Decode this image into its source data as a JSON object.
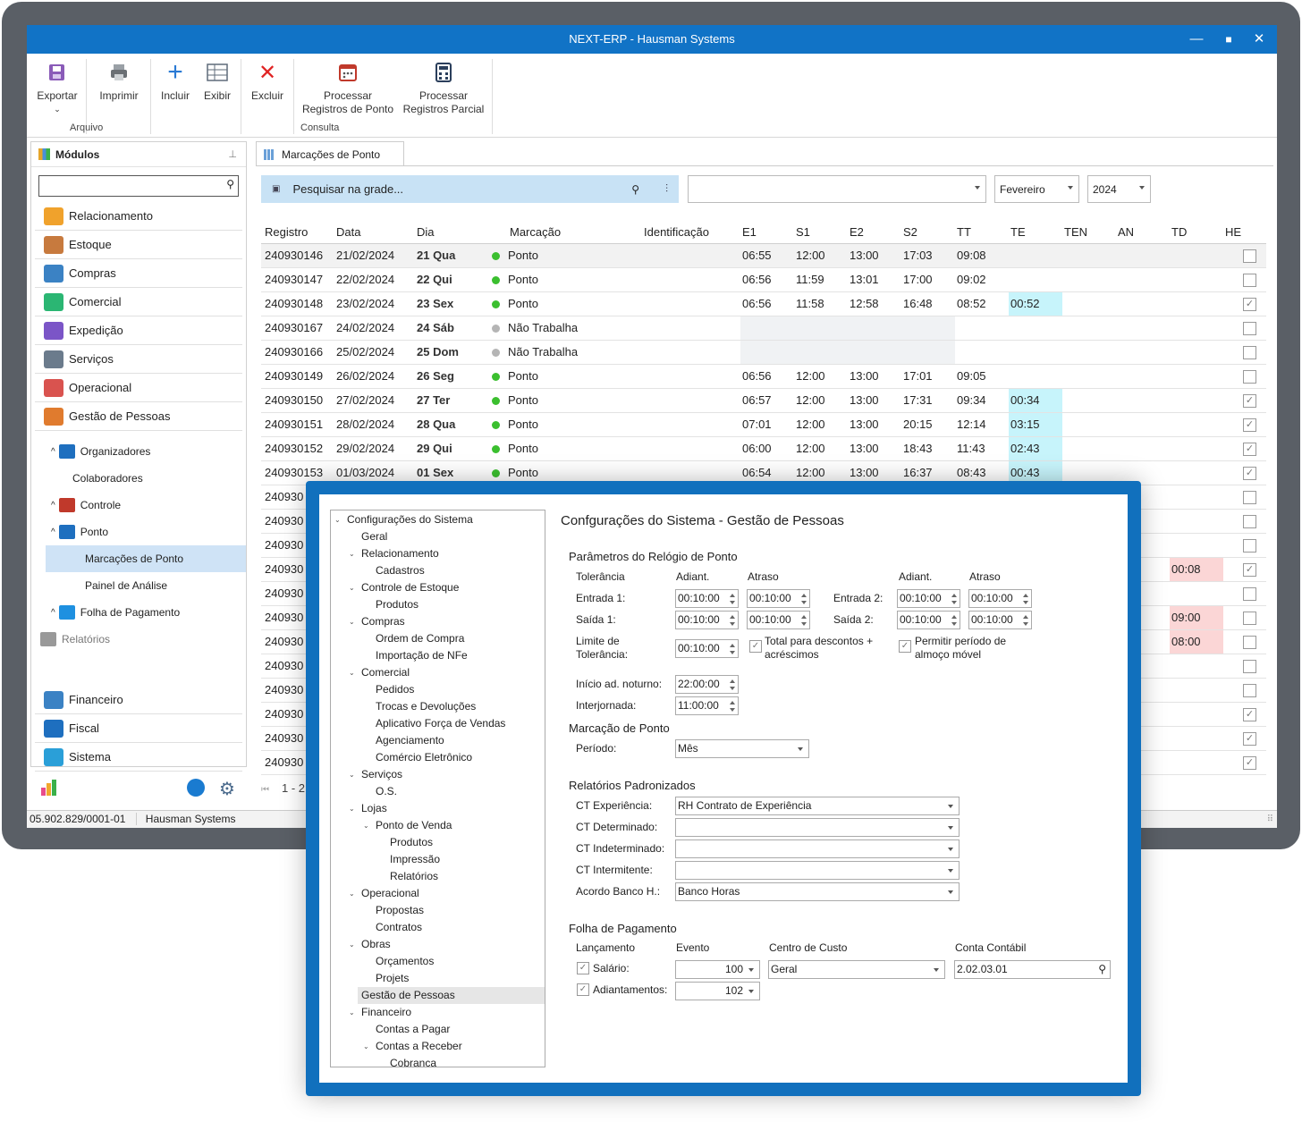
{
  "window": {
    "title": "NEXT-ERP - Hausman Systems",
    "min": "—",
    "max": "☐",
    "close": "✕"
  },
  "ribbon": {
    "export": "Exportar",
    "print": "Imprimir",
    "include": "Incluir",
    "show": "Exibir",
    "delete": "Excluir",
    "process": "Processar Registros de Ponto",
    "process_partial": "Processar Registros Parcial",
    "group_file": "Arquivo",
    "group_query": "Consulta"
  },
  "sidebar": {
    "title": "Módulos",
    "pin": "⊥",
    "modules": [
      "Relacionamento",
      "Estoque",
      "Compras",
      "Comercial",
      "Expedição",
      "Serviços",
      "Operacional",
      "Gestão de Pessoas"
    ],
    "tree": [
      "Organizadores",
      "Colaboradores",
      "Controle",
      "Ponto",
      "Marcações de Ponto",
      "Painel de Análise",
      "Folha de Pagamento",
      "Relatórios"
    ],
    "bottom": [
      "Financeiro",
      "Fiscal",
      "Sistema"
    ]
  },
  "status": {
    "cnpj": "05.902.829/0001-01",
    "company": "Hausman Systems"
  },
  "tab": {
    "label": "Marcações de Ponto"
  },
  "search": {
    "placeholder": "Pesquisar na grade..."
  },
  "filters": {
    "empty": "",
    "month": "Fevereiro",
    "year": "2024"
  },
  "grid": {
    "columns": [
      "Registro",
      "Data",
      "Dia",
      "Marcação",
      "Identificação",
      "E1",
      "S1",
      "E2",
      "S2",
      "TT",
      "TE",
      "TEN",
      "AN",
      "TD",
      "HE"
    ],
    "rows": [
      {
        "reg": "240930146",
        "date": "21/02/2024",
        "day": "21 Qua",
        "type": "Ponto",
        "dot": "#3bbf2f",
        "e1": "06:55",
        "s1": "12:00",
        "e2": "13:00",
        "s2": "17:03",
        "tt": "09:08",
        "te": "",
        "td": "",
        "he": false
      },
      {
        "reg": "240930147",
        "date": "22/02/2024",
        "day": "22 Qui",
        "type": "Ponto",
        "dot": "#3bbf2f",
        "e1": "06:56",
        "s1": "11:59",
        "e2": "13:01",
        "s2": "17:00",
        "tt": "09:02",
        "te": "",
        "td": "",
        "he": false
      },
      {
        "reg": "240930148",
        "date": "23/02/2024",
        "day": "23 Sex",
        "type": "Ponto",
        "dot": "#3bbf2f",
        "e1": "06:56",
        "s1": "11:58",
        "e2": "12:58",
        "s2": "16:48",
        "tt": "08:52",
        "te": "00:52",
        "td": "",
        "he": true
      },
      {
        "reg": "240930167",
        "date": "24/02/2024",
        "day": "24 Sáb",
        "type": "Não Trabalha",
        "dot": "#b5b5b5",
        "e1": "",
        "s1": "",
        "e2": "",
        "s2": "",
        "tt": "",
        "te": "",
        "td": "",
        "he": false
      },
      {
        "reg": "240930166",
        "date": "25/02/2024",
        "day": "25 Dom",
        "type": "Não Trabalha",
        "dot": "#b5b5b5",
        "e1": "",
        "s1": "",
        "e2": "",
        "s2": "",
        "tt": "",
        "te": "",
        "td": "",
        "he": false
      },
      {
        "reg": "240930149",
        "date": "26/02/2024",
        "day": "26 Seg",
        "type": "Ponto",
        "dot": "#3bbf2f",
        "e1": "06:56",
        "s1": "12:00",
        "e2": "13:00",
        "s2": "17:01",
        "tt": "09:05",
        "te": "",
        "td": "",
        "he": false
      },
      {
        "reg": "240930150",
        "date": "27/02/2024",
        "day": "27 Ter",
        "type": "Ponto",
        "dot": "#3bbf2f",
        "e1": "06:57",
        "s1": "12:00",
        "e2": "13:00",
        "s2": "17:31",
        "tt": "09:34",
        "te": "00:34",
        "td": "",
        "he": true
      },
      {
        "reg": "240930151",
        "date": "28/02/2024",
        "day": "28 Qua",
        "type": "Ponto",
        "dot": "#3bbf2f",
        "e1": "07:01",
        "s1": "12:00",
        "e2": "13:00",
        "s2": "20:15",
        "tt": "12:14",
        "te": "03:15",
        "td": "",
        "he": true
      },
      {
        "reg": "240930152",
        "date": "29/02/2024",
        "day": "29 Qui",
        "type": "Ponto",
        "dot": "#3bbf2f",
        "e1": "06:00",
        "s1": "12:00",
        "e2": "13:00",
        "s2": "18:43",
        "tt": "11:43",
        "te": "02:43",
        "td": "",
        "he": true
      },
      {
        "reg": "240930153",
        "date": "01/03/2024",
        "day": "01 Sex",
        "type": "Ponto",
        "dot": "#3bbf2f",
        "e1": "06:54",
        "s1": "12:00",
        "e2": "13:00",
        "s2": "16:37",
        "tt": "08:43",
        "te": "00:43",
        "td": "",
        "he": true
      },
      {
        "reg": "240930",
        "td": "",
        "he": false
      },
      {
        "reg": "240930",
        "td": "",
        "he": false
      },
      {
        "reg": "240930",
        "td": "",
        "he": false
      },
      {
        "reg": "240930",
        "td": "00:08",
        "he": true
      },
      {
        "reg": "240930",
        "td": "",
        "he": false
      },
      {
        "reg": "240930",
        "td": "09:00",
        "he": false
      },
      {
        "reg": "240930",
        "td": "08:00",
        "he": false
      },
      {
        "reg": "240930",
        "td": "",
        "he": false
      },
      {
        "reg": "240930",
        "td": "",
        "he": false
      },
      {
        "reg": "240930",
        "td": "",
        "he": true
      },
      {
        "reg": "240930",
        "td": "",
        "he": true
      },
      {
        "reg": "240930",
        "td": "",
        "he": true
      }
    ]
  },
  "pager": {
    "text": "1 - 2"
  },
  "dialog": {
    "title": "Confgurações do Sistema - Gestão de Pessoas",
    "tree": [
      {
        "t": "Configurações do Sistema",
        "l": 0,
        "ex": "v"
      },
      {
        "t": "Geral",
        "l": 1
      },
      {
        "t": "Relacionamento",
        "l": 1,
        "ex": "v"
      },
      {
        "t": "Cadastros",
        "l": 2
      },
      {
        "t": "Controle de Estoque",
        "l": 1,
        "ex": "v"
      },
      {
        "t": "Produtos",
        "l": 2
      },
      {
        "t": "Compras",
        "l": 1,
        "ex": "v"
      },
      {
        "t": "Ordem de Compra",
        "l": 2
      },
      {
        "t": "Importação de NFe",
        "l": 2
      },
      {
        "t": "Comercial",
        "l": 1,
        "ex": "v"
      },
      {
        "t": "Pedidos",
        "l": 2
      },
      {
        "t": "Trocas e Devoluções",
        "l": 2
      },
      {
        "t": "Aplicativo Força de Vendas",
        "l": 2
      },
      {
        "t": "Agenciamento",
        "l": 2
      },
      {
        "t": "Comércio Eletrônico",
        "l": 2
      },
      {
        "t": "Serviços",
        "l": 1,
        "ex": "v"
      },
      {
        "t": "O.S.",
        "l": 2
      },
      {
        "t": "Lojas",
        "l": 1,
        "ex": "v"
      },
      {
        "t": "Ponto de Venda",
        "l": 2,
        "ex": "v"
      },
      {
        "t": "Produtos",
        "l": 3
      },
      {
        "t": "Impressão",
        "l": 3
      },
      {
        "t": "Relatórios",
        "l": 3
      },
      {
        "t": "Operacional",
        "l": 1,
        "ex": "v"
      },
      {
        "t": "Propostas",
        "l": 2
      },
      {
        "t": "Contratos",
        "l": 2
      },
      {
        "t": "Obras",
        "l": 1,
        "ex": "v"
      },
      {
        "t": "Orçamentos",
        "l": 2
      },
      {
        "t": "Projets",
        "l": 2
      },
      {
        "t": "Gestão de Pessoas",
        "l": 1,
        "sel": true
      },
      {
        "t": "Financeiro",
        "l": 1,
        "ex": "v"
      },
      {
        "t": "Contas a Pagar",
        "l": 2
      },
      {
        "t": "Contas a Receber",
        "l": 2,
        "ex": "v"
      },
      {
        "t": "Cobrança",
        "l": 3
      }
    ],
    "clock": {
      "section": "Parâmetros do Relógio de Ponto",
      "tol": "Tolerância",
      "adiant": "Adiant.",
      "atraso": "Atraso",
      "e1": "Entrada 1:",
      "s1": "Saída 1:",
      "e2": "Entrada 2:",
      "s2": "Saída 2:",
      "limit": "Limite de Tolerância:",
      "v": "00:10:00",
      "total": "Total para descontos + acréscimos",
      "lunch": "Permitir período de almoço móvel",
      "night": "Início ad. noturno:",
      "night_v": "22:00:00",
      "inter": "Interjornada:",
      "inter_v": "11:00:00"
    },
    "mark": {
      "section": "Marcação de Ponto",
      "period": "Período:",
      "period_v": "Mês"
    },
    "reports": {
      "section": "Relatórios Padronizados",
      "exp": "CT Experiência:",
      "exp_v": "RH Contrato de Experiência",
      "det": "CT Determinado:",
      "indet": "CT Indeterminado:",
      "inter": "CT Intermitente:",
      "bank": "Acordo Banco H.:",
      "bank_v": "Banco Horas"
    },
    "payroll": {
      "section": "Folha de Pagamento",
      "launch": "Lançamento",
      "event": "Evento",
      "cost": "Centro de Custo",
      "account": "Conta Contábil",
      "salary": "Salário:",
      "salary_ev": "100",
      "salary_cc": "Geral",
      "salary_acc": "2.02.03.01",
      "adv": "Adiantamentos:",
      "adv_ev": "102"
    }
  }
}
